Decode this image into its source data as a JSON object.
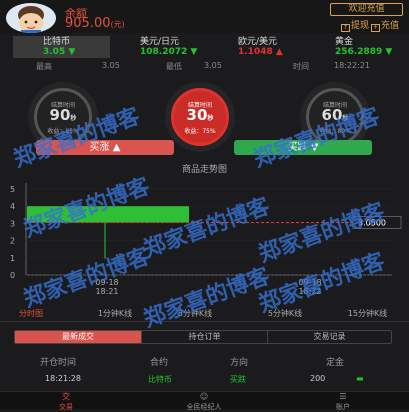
{
  "header": {
    "balance_label": "余额",
    "balance_value": "905.00",
    "balance_unit": "(元)",
    "welcome_label": "欢迎充值",
    "withdraw_label": "提现",
    "recharge_label": "充值"
  },
  "ticker": [
    {
      "name": "比特币",
      "value": "3.05",
      "arrow": "▼",
      "color": "#23c32c"
    },
    {
      "name": "美元/日元",
      "value": "108.2072",
      "arrow": "▼",
      "color": "#23c32c"
    },
    {
      "name": "欧元/美元",
      "value": "1.1048",
      "arrow": "▲",
      "color": "#e0322c"
    },
    {
      "name": "黄金",
      "value": "256.2889",
      "arrow": "▼",
      "color": "#23c32c"
    }
  ],
  "stats": {
    "high_label": "最高",
    "high_value": "3.05",
    "low_label": "最低",
    "low_value": "3.05",
    "time_label": "时间",
    "time_value": "18:22:21"
  },
  "gauges": [
    {
      "label": "结算时间",
      "seconds": "90",
      "unit": "秒",
      "rate": "收益：85%"
    },
    {
      "label": "结算时间",
      "seconds": "30",
      "unit": "秒",
      "rate": "收益：75%"
    },
    {
      "label": "结算时间",
      "seconds": "60",
      "unit": "秒",
      "rate": "收益：80%"
    }
  ],
  "buttons": {
    "rise": "买涨",
    "fall": "买跌"
  },
  "chart_title": "商品走势图",
  "chart_data": {
    "type": "bar",
    "y_ticks": [
      "5",
      "4",
      "3",
      "2",
      "1",
      "0"
    ],
    "ylim": [
      0,
      5
    ],
    "bars": [
      {
        "open": 4.0,
        "close": 3.05,
        "low": 0.95,
        "high": 4.0
      }
    ],
    "x_ticks": [
      {
        "date": "09-18",
        "time": "18:21"
      },
      {
        "date": "09-18",
        "time": "18:22"
      }
    ],
    "last_price": "3.0500",
    "up_color": "#2fbf36",
    "price_line_color": "#e03a2e"
  },
  "tabs": [
    "分时图",
    "1分钟K线",
    "3分钟K线",
    "5分钟K线",
    "15分钟K线"
  ],
  "subtabs": [
    "最新成交",
    "持仓订单",
    "交易记录"
  ],
  "table": {
    "headers": [
      "开仓时间",
      "合约",
      "方向",
      "定金"
    ],
    "rows": [
      {
        "time": "18:21:28",
        "contract": "比特币",
        "direction": "买跌",
        "deposit": "200"
      }
    ]
  },
  "nav": [
    {
      "icon": "交",
      "label": "交易"
    },
    {
      "icon": "☺",
      "label": "全民经纪人"
    },
    {
      "icon": "☰",
      "label": "账户"
    }
  ],
  "watermark": "郑家喜的博客"
}
